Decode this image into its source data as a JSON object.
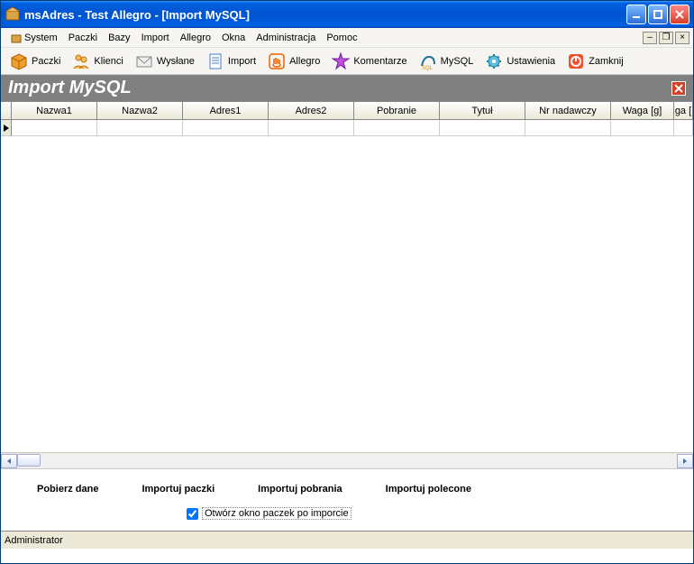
{
  "window": {
    "title": "msAdres - Test Allegro - [Import MySQL]"
  },
  "menu": {
    "items": [
      "System",
      "Paczki",
      "Bazy",
      "Import",
      "Allegro",
      "Okna",
      "Administracja",
      "Pomoc"
    ]
  },
  "toolbar": {
    "paczki": "Paczki",
    "klienci": "Klienci",
    "wyslane": "Wysłane",
    "import": "Import",
    "allegro": "Allegro",
    "komentarze": "Komentarze",
    "mysql": "MySQL",
    "ustawienia": "Ustawienia",
    "zamknij": "Zamknij"
  },
  "panel": {
    "title": "Import MySQL"
  },
  "grid": {
    "columns": [
      "Nazwa1",
      "Nazwa2",
      "Adres1",
      "Adres2",
      "Pobranie",
      "Tytuł",
      "Nr nadawczy",
      "Waga [g]",
      "ga ["
    ]
  },
  "actions": {
    "pobierz": "Pobierz dane",
    "importuj_paczki": "Importuj paczki",
    "importuj_pobrania": "Importuj pobrania",
    "importuj_polecone": "Importuj polecone",
    "checkbox_label": "Otwórz okno paczek po imporcie"
  },
  "status": {
    "user": "Administrator"
  },
  "colors": {
    "title_gradient_top": "#3a95ff",
    "title_gradient_bottom": "#0053d0",
    "panel_header": "#808080",
    "close_red": "#d43f28"
  }
}
